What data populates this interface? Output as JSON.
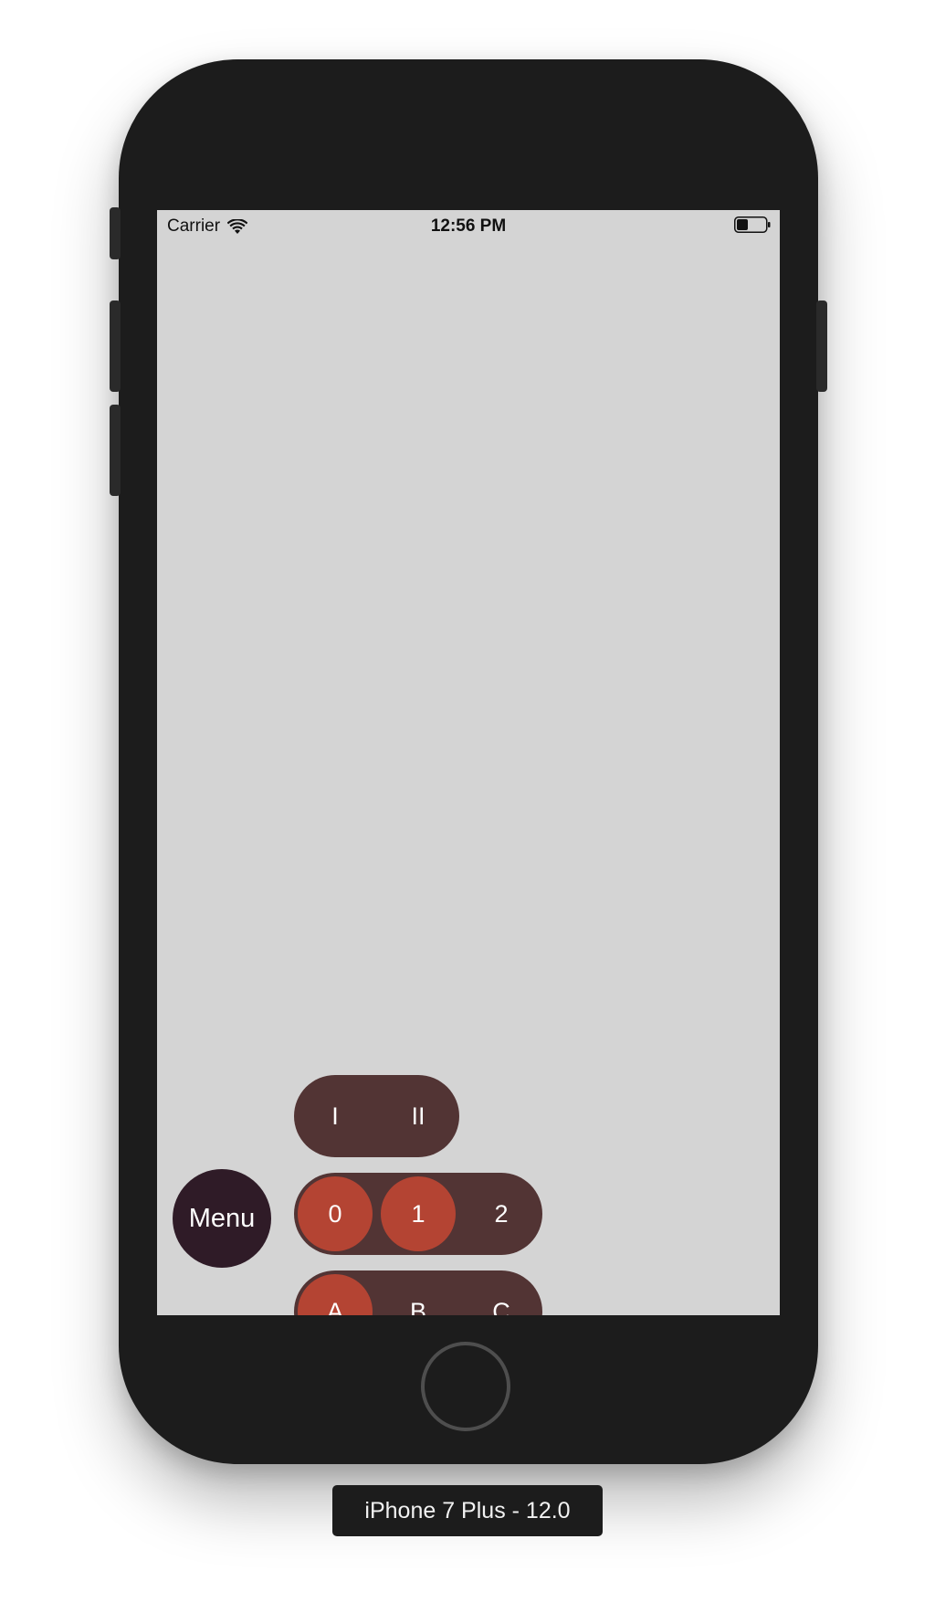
{
  "status_bar": {
    "carrier": "Carrier",
    "time": "12:56 PM",
    "wifi_icon": "wifi-icon",
    "battery_icon": "battery-icon"
  },
  "screen": {
    "background": "#d4d4d4"
  },
  "roman_group": {
    "items": [
      "I",
      "II"
    ]
  },
  "number_group": {
    "items": [
      "0",
      "1",
      "2"
    ],
    "selected": [
      "0",
      "1"
    ]
  },
  "letter_group": {
    "items": [
      "A",
      "B",
      "C"
    ],
    "selected": [
      "A"
    ]
  },
  "menu_button": {
    "label": "Menu"
  },
  "device_label": "iPhone 7 Plus - 12.0",
  "colors": {
    "pill_background": "#523434",
    "selected_item": "#b44433",
    "menu_button": "#2f1b27",
    "device_body": "#1c1c1c"
  }
}
